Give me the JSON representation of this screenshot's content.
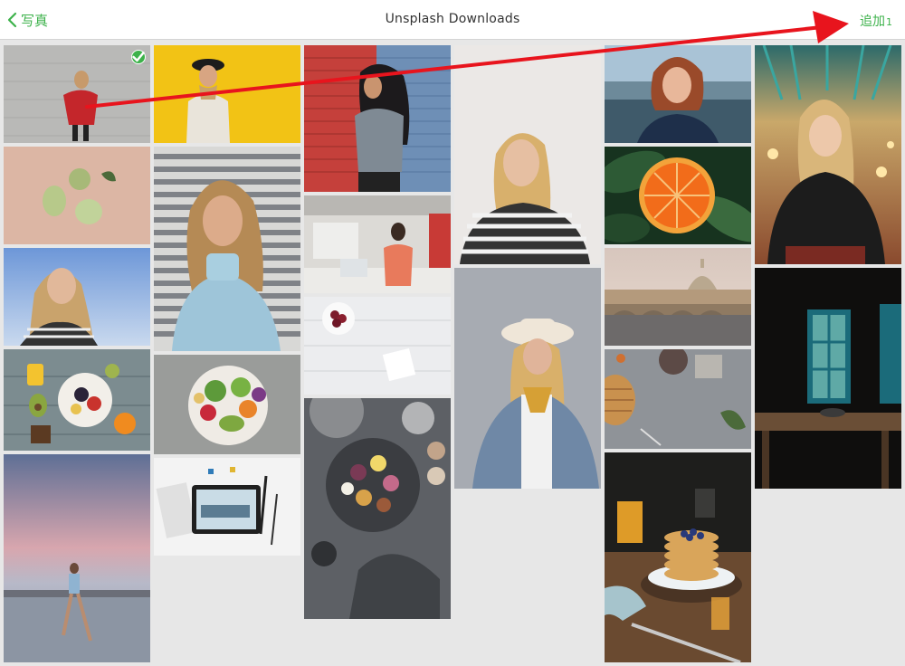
{
  "header": {
    "back_label": "写真",
    "title": "Unsplash Downloads",
    "add_label": "追加",
    "add_count": "1"
  },
  "colors": {
    "accent": "#3db24b",
    "annotation_arrow": "#e8141d"
  },
  "photos": [
    {
      "name": "photo-woman-red-sweater-white-wall",
      "selected": true
    },
    {
      "name": "photo-woman-black-hat-yellow-wall",
      "selected": false
    },
    {
      "name": "photo-woman-gray-sweater-brick-wall",
      "selected": false
    },
    {
      "name": "photo-blonde-woman-striped-shirt",
      "selected": false
    },
    {
      "name": "photo-redhead-woman-lake",
      "selected": false
    },
    {
      "name": "photo-blonde-woman-gallery",
      "selected": false
    },
    {
      "name": "photo-pears-pink-background",
      "selected": false
    },
    {
      "name": "photo-blonde-woman-blue-turtleneck",
      "selected": false
    },
    {
      "name": "photo-woman-office",
      "selected": false
    },
    {
      "name": "photo-orange-slice-leaves",
      "selected": false
    },
    {
      "name": "photo-woman-glasses-blue-sky",
      "selected": false
    },
    {
      "name": "photo-cherries-white-table",
      "selected": false
    },
    {
      "name": "photo-woman-hat-denim-jacket",
      "selected": false
    },
    {
      "name": "photo-rome-vatican-river",
      "selected": false
    },
    {
      "name": "photo-dark-room-window-table",
      "selected": false
    },
    {
      "name": "photo-avocado-breakfast-table",
      "selected": false
    },
    {
      "name": "photo-salad-bowl",
      "selected": false
    },
    {
      "name": "photo-baking-table-pie",
      "selected": false
    },
    {
      "name": "photo-food-platter-figs",
      "selected": false
    },
    {
      "name": "photo-woman-beach-sunset",
      "selected": false
    },
    {
      "name": "photo-tablet-desk-flatlay",
      "selected": false
    },
    {
      "name": "photo-pancakes-blueberries",
      "selected": false
    }
  ]
}
